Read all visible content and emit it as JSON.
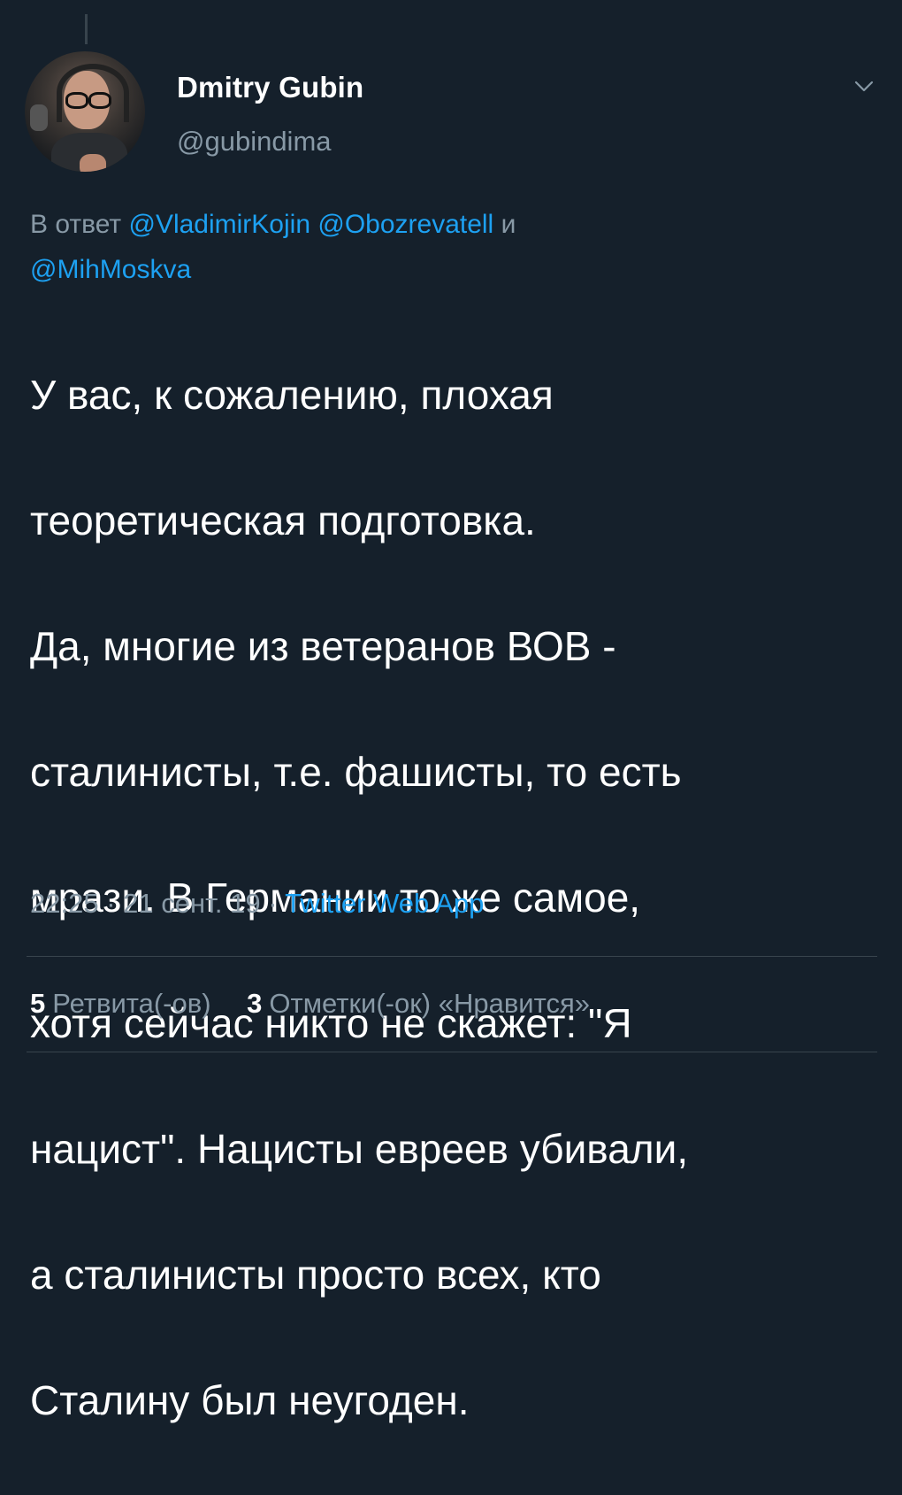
{
  "tweet": {
    "author": {
      "display_name": "Dmitry Gubin",
      "handle": "@gubindima"
    },
    "reply_to": {
      "prefix": "В ответ",
      "mentions": [
        "@VladimirKojin",
        "@Obozrevatell",
        "@MihMoskva"
      ],
      "conjunction": "и"
    },
    "text_lines": [
      "У вас, к сожалению, плохая",
      "теоретическая подготовка.",
      "Да, многие из ветеранов ВОВ -",
      "сталинисты, т.е. фашисты, то есть",
      "мрази. В Германии то же самое,",
      "хотя сейчас никто не скажет: \"Я",
      "нацист\". Нацисты евреев убивали,",
      "а сталинисты просто всех, кто",
      "Сталину был неугоден."
    ],
    "meta": {
      "time": "22:25",
      "separator": "·",
      "date": "21 сент. 19",
      "source_app": "Twitter Web App"
    },
    "stats": {
      "retweets_count": "5",
      "retweets_label": "Ретвита(-ов)",
      "likes_count": "3",
      "likes_label": "Отметки(-ок) «Нравится»"
    }
  },
  "icons": {
    "menu": "chevron-down-icon"
  },
  "colors": {
    "background": "#15202b",
    "text": "#ffffff",
    "secondary_text": "#8899a6",
    "accent": "#1da1f2",
    "divider": "#38444d"
  }
}
